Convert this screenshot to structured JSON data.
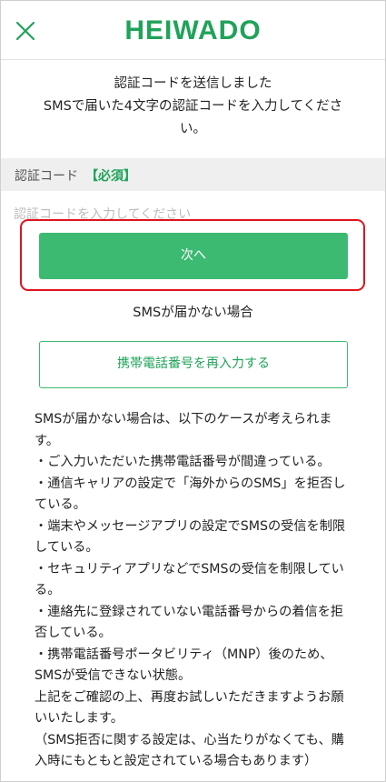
{
  "header": {
    "logo_text": "HEIWADO",
    "brand_color": "#1fa35a",
    "close_icon": "close-icon"
  },
  "message": {
    "lines": [
      "認証コードを送信しました",
      "SMSで届いた4文字の認証コードを入力してくださ",
      "い。"
    ]
  },
  "code_field": {
    "label": "認証コード",
    "required": "【必須】",
    "placeholder": "認証コードを入力してください",
    "value": ""
  },
  "buttons": {
    "next_label": "次へ",
    "next_color": "#3dba72",
    "reenter_label": "携帯電話番号を再入力する"
  },
  "no_sms_heading": "SMSが届かない場合",
  "notes": {
    "lines": [
      "SMSが届かない場合は、以下のケースが考えられま",
      "す。",
      "・ご入力いただいた携帯電話番号が間違っている。",
      "・通信キャリアの設定で「海外からのSMS」を拒否し",
      "ている。",
      "・端末やメッセージアプリの設定でSMSの受信を制限",
      "している。",
      "・セキュリティアプリなどでSMSの受信を制限してい",
      "る。",
      "・連絡先に登録されていない電話番号からの着信を拒",
      "否している。",
      "・携帯電話番号ポータビリティ（MNP）後のため、",
      "SMSが受信できない状態。",
      "上記をご確認の上、再度お試しいただきますようお願",
      "いいたします。",
      "（SMS拒否に関する設定は、心当たりがなくても、購",
      "入時にもともと設定されている場合もあります）"
    ]
  }
}
